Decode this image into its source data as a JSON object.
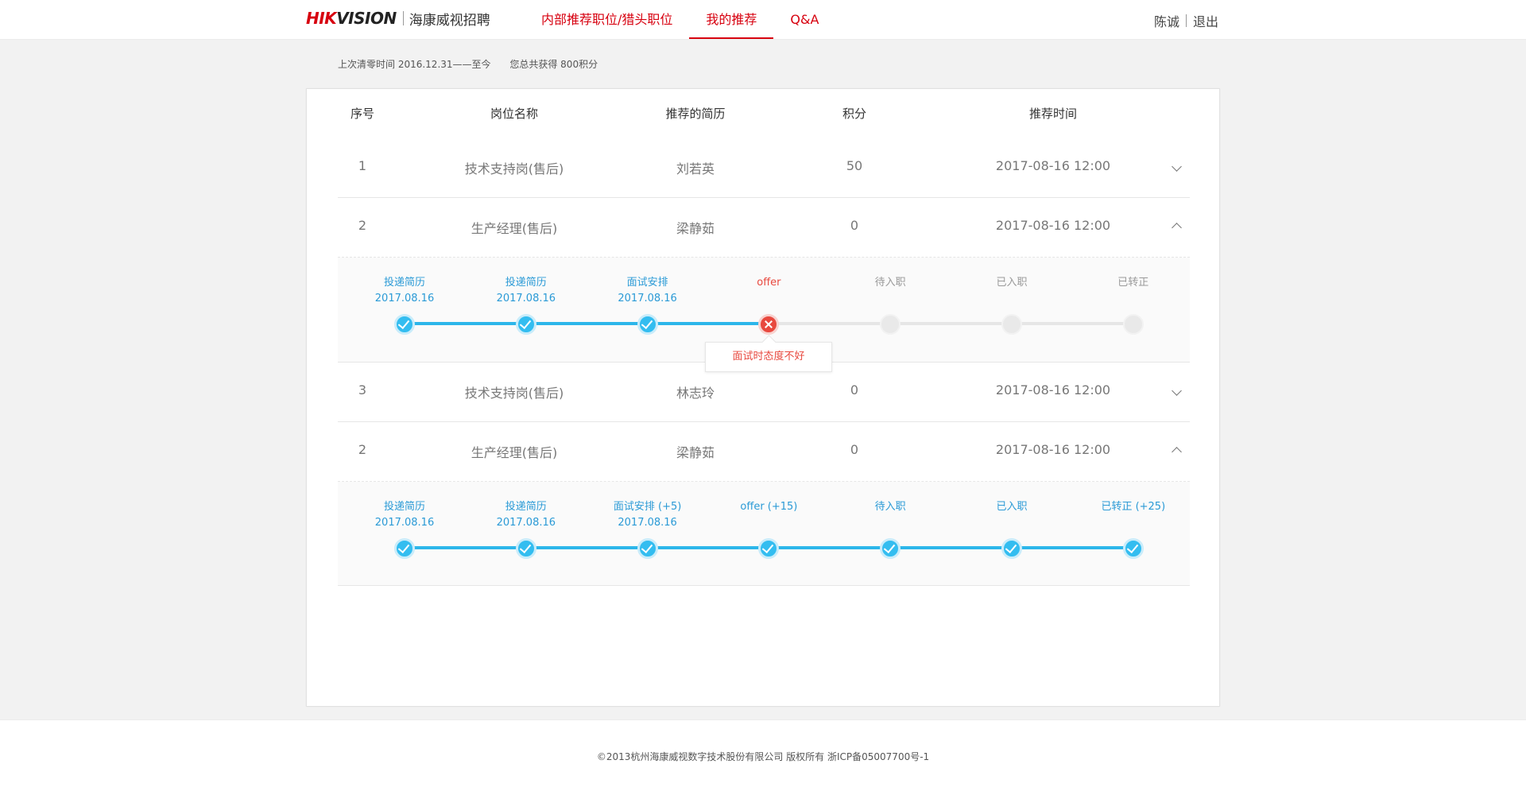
{
  "header": {
    "logo_brand_red": "HIK",
    "logo_brand_dark": "VISION",
    "logo_cn": "海康威视招聘",
    "nav": [
      {
        "label": "内部推荐职位/猎头职位"
      },
      {
        "label": "我的推荐"
      },
      {
        "label": "Q&A"
      }
    ],
    "active_nav": "我的推荐",
    "user_name": "陈诚",
    "logout": "退出"
  },
  "summary": {
    "reset_time": "上次清零时间 2016.12.31——至今",
    "points": "您总共获得 800积分"
  },
  "table": {
    "headers": [
      "序号",
      "岗位名称",
      "推荐的简历",
      "积分",
      "推荐时间"
    ],
    "rows": [
      {
        "no": "1",
        "position": "技术支持岗(售后)",
        "resume": "刘若英",
        "points": "50",
        "time": "2017-08-16  12:00",
        "expanded": false
      },
      {
        "no": "2",
        "position": "生产经理(售后)",
        "resume": "梁静茹",
        "points": "0",
        "time": "2017-08-16  12:00",
        "expanded": true
      },
      {
        "no": "3",
        "position": "技术支持岗(售后)",
        "resume": "林志玲",
        "points": "0",
        "time": "2017-08-16  12:00",
        "expanded": false
      },
      {
        "no": "2",
        "position": "生产经理(售后)",
        "resume": "梁静茹",
        "points": "0",
        "time": "2017-08-16  12:00",
        "expanded": true
      }
    ]
  },
  "progress1": {
    "steps": [
      {
        "label": "投递简历",
        "date": "2017.08.16",
        "state": "done"
      },
      {
        "label": "投递简历",
        "date": "2017.08.16",
        "state": "done"
      },
      {
        "label": "面试安排",
        "date": "2017.08.16",
        "state": "done"
      },
      {
        "label": "offer",
        "date": "",
        "state": "failed"
      },
      {
        "label": "待入职",
        "date": "",
        "state": "pending"
      },
      {
        "label": "已入职",
        "date": "",
        "state": "pending"
      },
      {
        "label": "已转正",
        "date": "",
        "state": "pending"
      }
    ],
    "fail_reason": "面试时态度不好",
    "progress_fraction": 0.5
  },
  "progress2": {
    "steps": [
      {
        "label": "投递简历",
        "date": "2017.08.16",
        "state": "done"
      },
      {
        "label": "投递简历",
        "date": "2017.08.16",
        "state": "done"
      },
      {
        "label": "面试安排  (+5)",
        "date": "2017.08.16",
        "state": "done"
      },
      {
        "label": "offer  (+15)",
        "date": "",
        "state": "done"
      },
      {
        "label": "待入职",
        "date": "",
        "state": "done"
      },
      {
        "label": "已入职",
        "date": "",
        "state": "done"
      },
      {
        "label": "已转正  (+25)",
        "date": "",
        "state": "done"
      }
    ],
    "progress_fraction": 1.0
  },
  "colors": {
    "brand_red": "#d7000f",
    "progress_blue": "#33bdf0",
    "fail_red": "#e8483e"
  },
  "icons": {
    "expand": "chevron-down-icon",
    "collapse": "chevron-up-icon",
    "done": "check-circle-icon",
    "failed": "x-circle-icon"
  },
  "footer": {
    "copyright": "©2013杭州海康威视数字技术股份有限公司 版权所有 浙ICP备05007700号-1"
  }
}
